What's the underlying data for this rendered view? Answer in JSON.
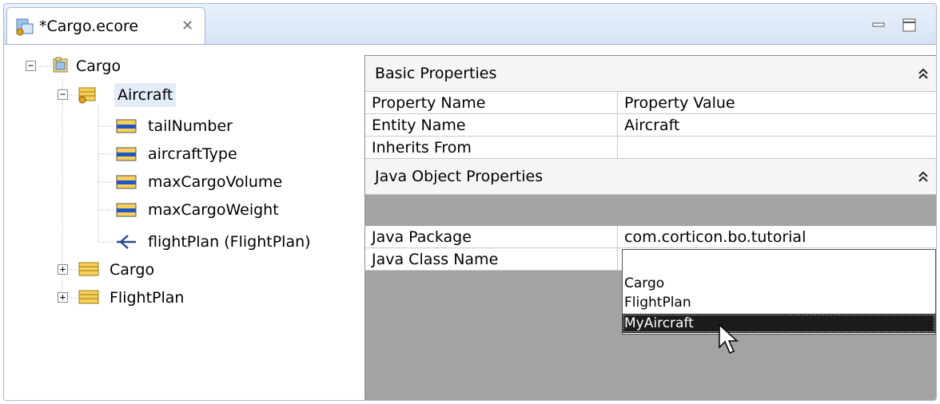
{
  "tab": {
    "title": "*Cargo.ecore",
    "close_glyph": "✕"
  },
  "window_controls": {
    "minimize": "minimize-icon",
    "maximize": "maximize-icon"
  },
  "tree": {
    "root": {
      "label": "Cargo",
      "expander": "−",
      "icon": "package-icon"
    },
    "entities": [
      {
        "label": "Aircraft",
        "expander": "−",
        "icon": "entity-icon",
        "selected": true,
        "children": [
          {
            "label": "tailNumber",
            "icon": "attribute-icon"
          },
          {
            "label": "aircraftType",
            "icon": "attribute-icon"
          },
          {
            "label": "maxCargoVolume",
            "icon": "attribute-icon"
          },
          {
            "label": "maxCargoWeight",
            "icon": "attribute-icon"
          },
          {
            "label": "flightPlan (FlightPlan)",
            "icon": "association-icon"
          }
        ]
      },
      {
        "label": "Cargo",
        "expander": "+",
        "icon": "entity-icon"
      },
      {
        "label": "FlightPlan",
        "expander": "+",
        "icon": "entity-icon"
      }
    ]
  },
  "properties": {
    "basic": {
      "title": "Basic Properties",
      "collapse_glyph": "⌃",
      "header": {
        "name": "Property Name",
        "value": "Property Value"
      },
      "rows": [
        {
          "name": "Entity Name",
          "value": "Aircraft"
        },
        {
          "name": "Inherits From",
          "value": ""
        }
      ]
    },
    "java": {
      "title": "Java Object Properties",
      "collapse_glyph": "⌃",
      "rows": [
        {
          "name": "Java Package",
          "value": "com.corticon.bo.tutorial"
        },
        {
          "name": "Java Class Name",
          "value": ""
        }
      ]
    }
  },
  "dropdown": {
    "options": [
      "",
      "Cargo",
      "FlightPlan",
      "MyAircraft"
    ],
    "highlighted": "MyAircraft"
  },
  "colors": {
    "tab_bar": "#d7e3f4",
    "selection_highlight": "#1b1b1b",
    "panel_gray": "#a3a3a3"
  }
}
